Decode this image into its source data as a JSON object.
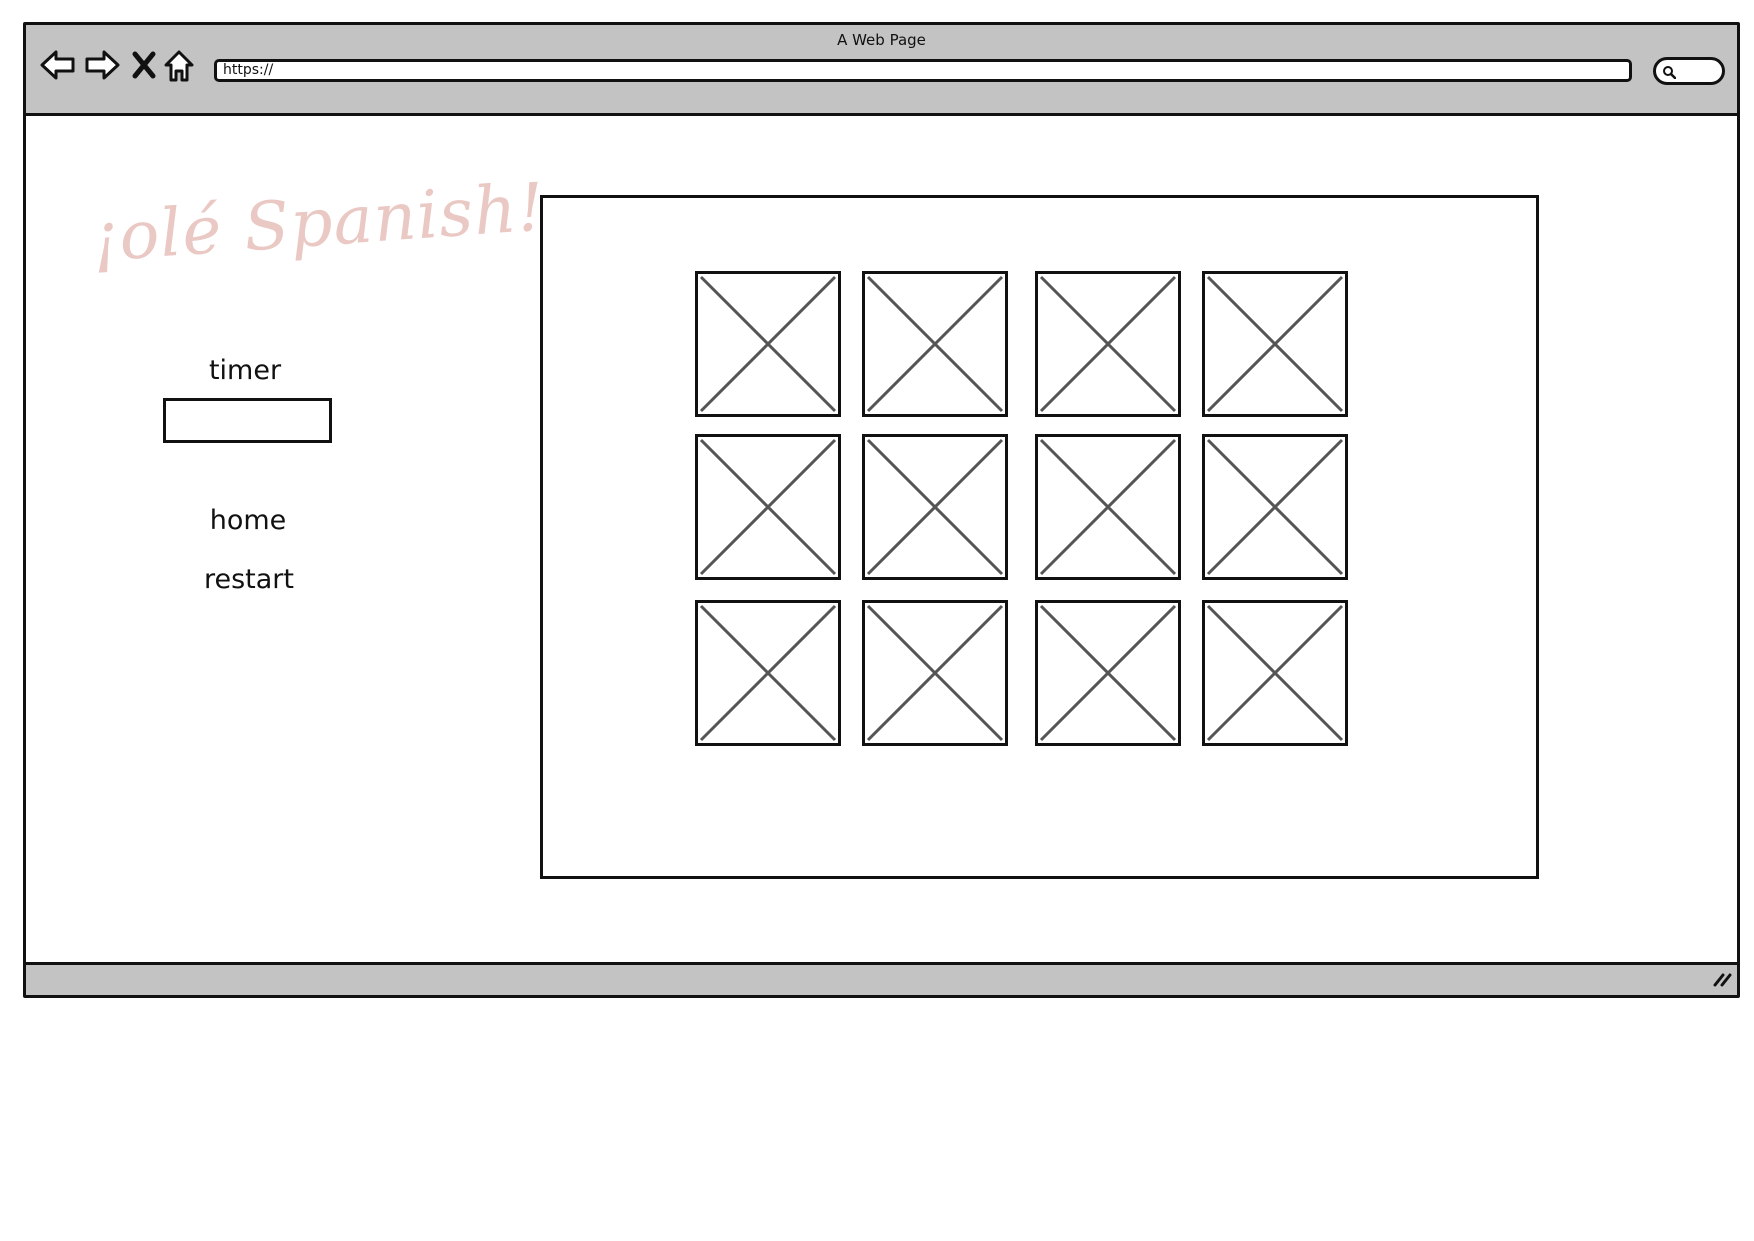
{
  "browser": {
    "title": "A Web Page",
    "url": "https://",
    "icons": [
      "back-arrow-icon",
      "forward-arrow-icon",
      "close-icon",
      "home-icon",
      "search-icon",
      "resize-grip-icon"
    ]
  },
  "sidebar": {
    "logo_text": "¡olé Spanish!",
    "timer_label": "timer",
    "timer_value": "",
    "nav": [
      {
        "label": "home"
      },
      {
        "label": "restart"
      }
    ]
  },
  "board": {
    "rows": 3,
    "columns": 4,
    "cards": [
      {
        "type": "image-placeholder"
      },
      {
        "type": "image-placeholder"
      },
      {
        "type": "image-placeholder"
      },
      {
        "type": "image-placeholder"
      },
      {
        "type": "image-placeholder"
      },
      {
        "type": "image-placeholder"
      },
      {
        "type": "image-placeholder"
      },
      {
        "type": "image-placeholder"
      },
      {
        "type": "image-placeholder"
      },
      {
        "type": "image-placeholder"
      },
      {
        "type": "image-placeholder"
      },
      {
        "type": "image-placeholder"
      }
    ]
  },
  "colors": {
    "chrome": "#c3c3c3",
    "outline": "#111111",
    "logo": "#eac8c4",
    "placeholder_cross": "#555555"
  }
}
